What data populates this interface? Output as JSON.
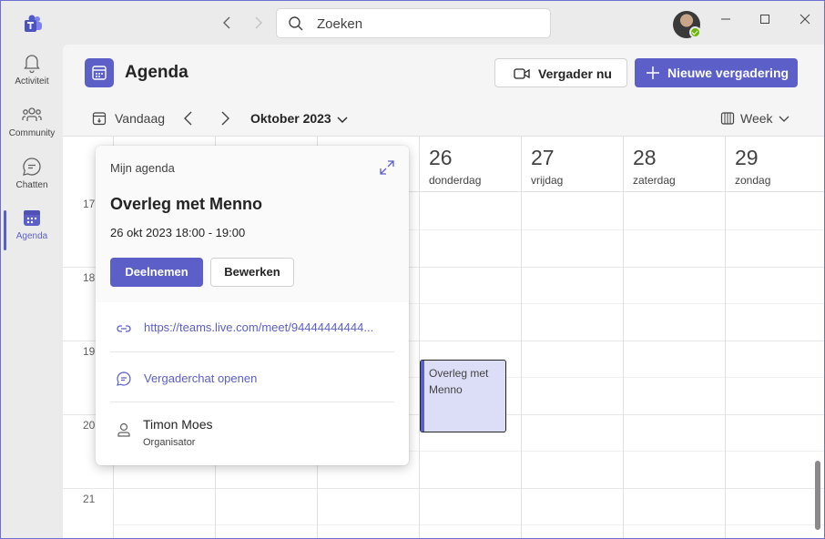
{
  "titlebar": {
    "search_placeholder": "Zoeken"
  },
  "rail": {
    "items": [
      {
        "label": "Activiteit",
        "icon": "bell-icon"
      },
      {
        "label": "Community",
        "icon": "community-icon"
      },
      {
        "label": "Chatten",
        "icon": "chat-icon"
      },
      {
        "label": "Agenda",
        "icon": "calendar-icon",
        "active": true
      }
    ]
  },
  "header": {
    "title": "Agenda",
    "meet_now_label": "Vergader nu",
    "new_meeting_label": "Nieuwe vergadering"
  },
  "toolbar": {
    "today_label": "Vandaag",
    "month_label": "Oktober 2023",
    "view_label": "Week"
  },
  "calendar": {
    "visible_days": [
      {
        "num": "26",
        "name": "donderdag"
      },
      {
        "num": "27",
        "name": "vrijdag"
      },
      {
        "num": "28",
        "name": "zaterdag"
      },
      {
        "num": "29",
        "name": "zondag"
      }
    ],
    "hours": [
      "17",
      "18",
      "19",
      "20",
      "21"
    ],
    "event": {
      "title": "Overleg met Menno"
    }
  },
  "popup": {
    "calendar_name": "Mijn agenda",
    "title": "Overleg met Menno",
    "time": "26 okt 2023 18:00 - 19:00",
    "join_label": "Deelnemen",
    "edit_label": "Bewerken",
    "link": "https://teams.live.com/meet/94444444444...",
    "chat_label": "Vergaderchat openen",
    "organizer_name": "Timon Moes",
    "organizer_role": "Organisator"
  },
  "colors": {
    "accent": "#5b5fc7",
    "event_bg": "#dcdef7",
    "presence": "#6bb700"
  }
}
